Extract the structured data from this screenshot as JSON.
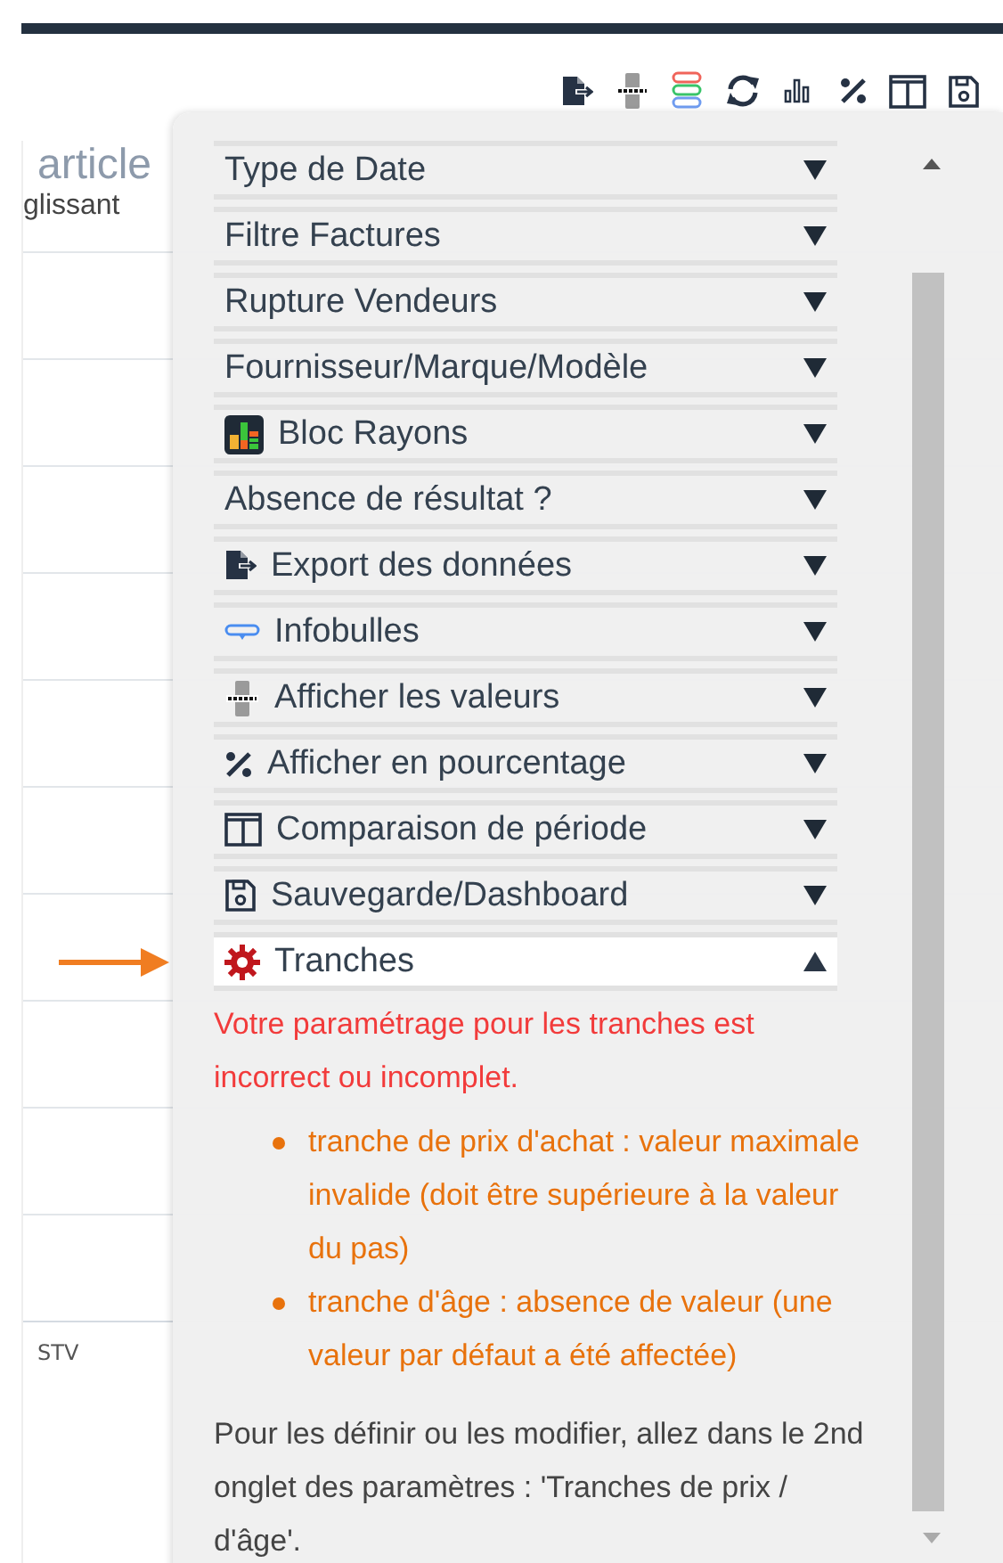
{
  "background": {
    "heading": "article",
    "subheading": "glissant",
    "row_label": "STV"
  },
  "panel": {
    "sections": [
      {
        "label": "Type de Date",
        "kind": "plain",
        "expanded": false
      },
      {
        "label": "Filtre Factures",
        "kind": "plain",
        "expanded": false
      },
      {
        "label": "Rupture Vendeurs",
        "kind": "plain",
        "expanded": false
      },
      {
        "label": "Fournisseur/Marque/Modèle",
        "kind": "plain",
        "expanded": false
      },
      {
        "label": "Bloc Rayons",
        "kind": "blocks",
        "expanded": false
      },
      {
        "label": "Absence de résultat ?",
        "kind": "plain",
        "expanded": false
      },
      {
        "label": "Export des données",
        "kind": "export",
        "expanded": false
      },
      {
        "label": "Infobulles",
        "kind": "tooltip",
        "expanded": false
      },
      {
        "label": "Afficher les valeurs",
        "kind": "values",
        "expanded": false
      },
      {
        "label": "Afficher en pourcentage",
        "kind": "percent",
        "expanded": false
      },
      {
        "label": "Comparaison de période",
        "kind": "columns",
        "expanded": false
      },
      {
        "label": "Sauvegarde/Dashboard",
        "kind": "save",
        "expanded": false
      },
      {
        "label": "Tranches",
        "kind": "gear",
        "expanded": true
      }
    ],
    "message": {
      "error": "Votre paramétrage pour les tranches est incorrect ou incomplet.",
      "issues": [
        "tranche de prix d'achat : valeur maximale invalide (doit être supérieure à la valeur du pas)",
        "tranche d'âge : absence de valeur (une valeur par défaut a été affectée)"
      ],
      "hint": "Pour les définir ou les modifier, allez dans le 2nd onglet des paramètres : 'Tranches de prix / d'âge'."
    }
  }
}
